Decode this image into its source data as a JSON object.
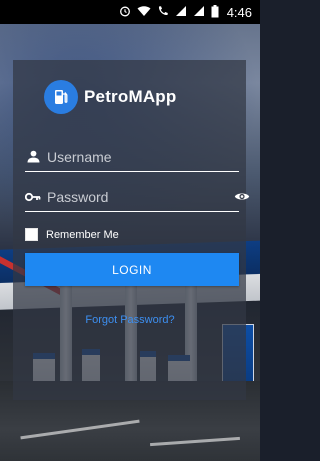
{
  "status_bar": {
    "time": "4:46",
    "icons": [
      "alarm-icon",
      "wifi-icon",
      "call-icon",
      "signal-icon",
      "signal-icon",
      "battery-icon"
    ]
  },
  "app": {
    "name": "PetroMApp",
    "logo_icon": "fuel-pump-icon"
  },
  "login_form": {
    "username_placeholder": "Username",
    "password_placeholder": "Password",
    "remember_label": "Remember Me",
    "remember_checked": false,
    "login_label": "LOGIN",
    "forgot_label": "Forgot Password?"
  },
  "colors": {
    "accent": "#1e88f2",
    "link": "#3d8ff0",
    "logo_badge": "#2a7de1"
  }
}
